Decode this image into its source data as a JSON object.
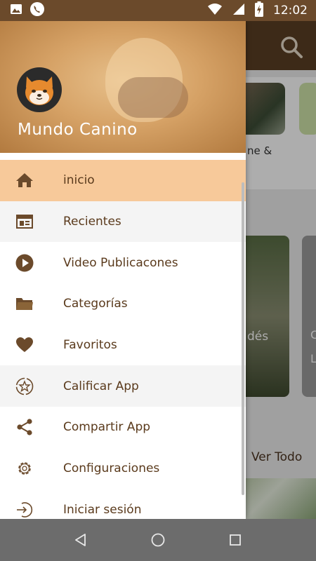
{
  "status_bar": {
    "time": "12:02",
    "icons": [
      "image-icon",
      "phone-icon",
      "wifi-icon",
      "signal-icon",
      "battery-charging-icon"
    ]
  },
  "background": {
    "thumb_label": "ne &",
    "video_text": "dés",
    "video_text2": "C",
    "video_text3": "L",
    "ver_todo": "Ver Todo"
  },
  "drawer": {
    "title": "Mundo Canino",
    "items": [
      {
        "label": "inicio",
        "icon": "home-icon",
        "state": "active"
      },
      {
        "label": "Recientes",
        "icon": "calendar-icon",
        "state": "normal"
      },
      {
        "label": "Video Publicacones",
        "icon": "play-icon",
        "state": "normal"
      },
      {
        "label": "Categorías",
        "icon": "folder-icon",
        "state": "normal"
      },
      {
        "label": "Favoritos",
        "icon": "heart-icon",
        "state": "normal"
      },
      {
        "label": "Calificar App",
        "icon": "star-badge-icon",
        "state": "shaded"
      },
      {
        "label": "Compartir App",
        "icon": "share-icon",
        "state": "normal"
      },
      {
        "label": "Configuraciones",
        "icon": "gear-icon",
        "state": "normal"
      },
      {
        "label": "Iniciar sesión",
        "icon": "login-icon",
        "state": "normal"
      }
    ]
  },
  "colors": {
    "status_bar": "#6b4a2b",
    "accent_active": "#f7c99a",
    "icon_brown": "#6b4a2b",
    "label_brown": "#5a3a1c",
    "nav_bar": "#6c6c6c"
  }
}
